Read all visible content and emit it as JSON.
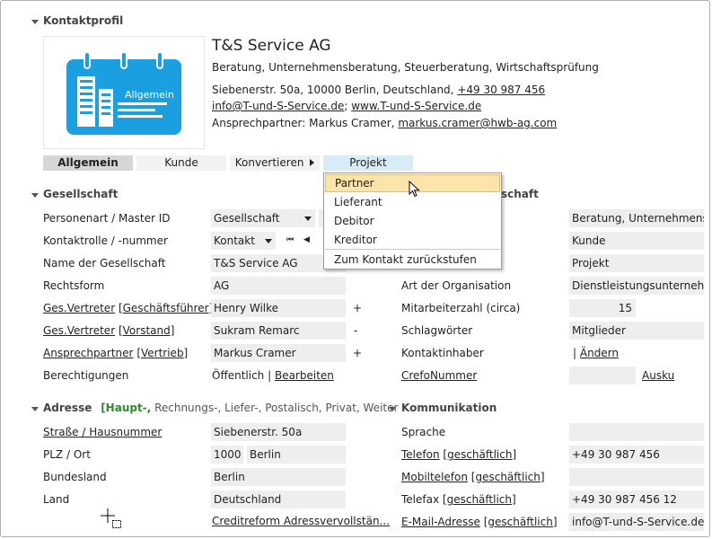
{
  "header": {
    "section_title": "Kontaktprofil"
  },
  "profile": {
    "logo_label": "Allgemein",
    "company_name": "T&S Service AG",
    "description": "Beratung, Unternehmensberatung, Steuerberatung, Wirtschaftsprüfung",
    "address_line": "Siebenerstr. 50a, 10000 Berlin, Deutschland,",
    "phone": "+49 30 987 456",
    "email": "info@T-und-S-Service.de",
    "separator": ";",
    "website": "www.T-und-S-Service.de",
    "contact_prefix": "Ansprechpartner: Markus Cramer,",
    "contact_email": "markus.cramer@hwb-ag.com"
  },
  "tabs": {
    "allgemein": "Allgemein",
    "kunde": "Kunde",
    "konvertieren": "Konvertieren",
    "projekt": "Projekt"
  },
  "menu": {
    "items": [
      "Partner",
      "Lieferant",
      "Debitor",
      "Kreditor"
    ],
    "bottom": "Zum Kontakt zurückstufen"
  },
  "gesellschaft": {
    "title": "Gesellschaft",
    "right_title_fragment": "schaft",
    "labels": {
      "personenart": "Personenart / Master ID",
      "kontaktrolle": "Kontaktrolle / -nummer",
      "name": "Name der Gesellschaft",
      "rechtsform": "Rechtsform",
      "gv1_a": "Ges.Vertreter",
      "gv1_b": "[Geschäftsführer]",
      "gv2_a": "Ges.Vertreter",
      "gv2_b": "[Vorstand]",
      "ap_a": "Ansprechpartner",
      "ap_b": "[Vertrieb]",
      "berechtigungen": "Berechtigungen"
    },
    "values": {
      "personenart": "Gesellschaft",
      "kontaktrolle": "Kontakt",
      "nav_first": "⏮",
      "nav_prev": "◀",
      "name": "T&S Service AG",
      "rechtsform": "AG",
      "gv1": "Henry Wilke",
      "gv1_sign": "+",
      "gv2": "Sukram Remarc",
      "gv2_sign": "-",
      "ap": "Markus Cramer",
      "ap_sign": "+",
      "berechtigungen": "Öffentlich |",
      "bearbeiten": "Bearbeiten"
    }
  },
  "right": {
    "labels": {
      "art": "Art der Organisation",
      "mitarbeiter": "Mitarbeiterzahl (circa)",
      "schlagwoerter": "Schlagwörter",
      "kontaktinhaber": "Kontaktinhaber",
      "crefo": "CrefoNummer"
    },
    "values": {
      "branche": "Beratung, Unternehmensb",
      "rolle": "Kunde",
      "status": "Projekt",
      "art": "Dienstleistungsunternehme",
      "mitarbeiter": "15",
      "schlagwoerter": "Mitglieder",
      "kontaktinhaber_sep": "|",
      "aendern": "Ändern",
      "auskunft": "Ausku"
    }
  },
  "adresse": {
    "title": "Adresse",
    "active_type": "[Haupt-,",
    "other_types": "Rechnungs-, Liefer-, Postalisch, Privat, Weiter",
    "labels": {
      "strasse": "Straße / Hausnummer",
      "plz": "PLZ / Ort",
      "bundesland": "Bundesland",
      "land": "Land"
    },
    "values": {
      "strasse": "Siebenerstr. 50a",
      "plz": "1000",
      "ort": "Berlin",
      "bundesland": "Berlin",
      "land": "Deutschland",
      "creditreform": "Creditreform Adressvervollstän..."
    }
  },
  "kommunikation": {
    "title": "Kommunikation",
    "labels": {
      "sprache": "Sprache",
      "telefon_a": "Telefon",
      "telefon_b": "[geschäftlich]",
      "mobil_a": "Mobiltelefon",
      "mobil_b": "[geschäftlich]",
      "telefax_a": "Telefax",
      "telefax_b": "[geschäftlich]",
      "email_a": "E-Mail-Adresse",
      "email_b": "[geschäftlich]"
    },
    "values": {
      "telefon": "+49 30 987 456",
      "telefax": "+49 30 987 456 12",
      "email": "info@T-und-S-Service.de"
    }
  },
  "colors": {
    "accent": "#1a9fe0",
    "field": "#eeeeee",
    "tab_active": "#d6d6d6",
    "tab_hover": "#d8ecf7",
    "menu_highlight": "#fbe4a9",
    "green": "#2e8b2e"
  }
}
